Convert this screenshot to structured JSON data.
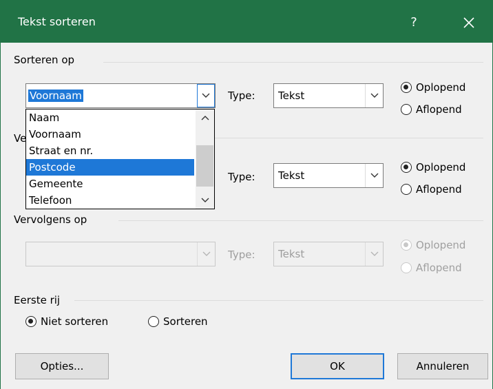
{
  "window": {
    "title": "Tekst sorteren",
    "help_label": "?"
  },
  "sort1": {
    "header": "Sorteren op",
    "field_value": "Voornaam",
    "type_label": "Type:",
    "type_value": "Tekst",
    "asc_label": "Oplopend",
    "desc_label": "Aflopend",
    "selected": "asc"
  },
  "dropdown": {
    "items": [
      "Naam",
      "Voornaam",
      "Straat en nr.",
      "Postcode",
      "Gemeente",
      "Telefoon"
    ],
    "highlighted": "Postcode"
  },
  "sort2": {
    "header": "Ve",
    "type_label": "Type:",
    "type_value": "Tekst",
    "asc_label": "Oplopend",
    "desc_label": "Aflopend",
    "selected": "asc"
  },
  "sort3": {
    "header": "Vervolgens op",
    "field_value": "",
    "type_label": "Type:",
    "type_value": "Tekst",
    "asc_label": "Oplopend",
    "desc_label": "Aflopend",
    "selected": "asc",
    "disabled": true
  },
  "first_row": {
    "header": "Eerste rij",
    "no_sort_label": "Niet sorteren",
    "sort_label": "Sorteren",
    "selected": "no_sort"
  },
  "buttons": {
    "options": "Opties...",
    "ok": "OK",
    "cancel": "Annuleren"
  },
  "colors": {
    "titlebar": "#217346",
    "selection": "#1e78d7"
  }
}
